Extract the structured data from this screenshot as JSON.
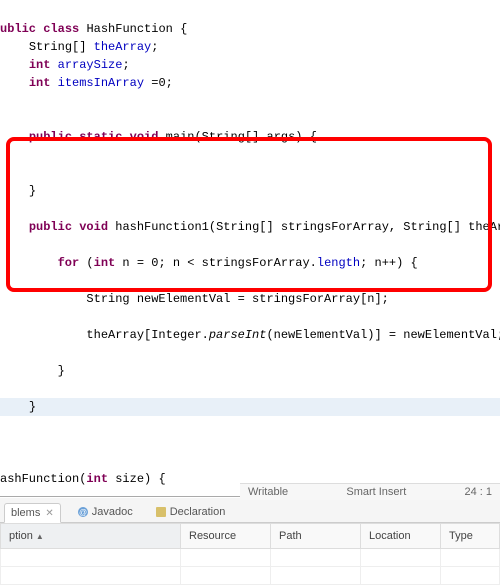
{
  "code": {
    "classDecl": {
      "kw1": "ublic",
      "kw2": "class",
      "name": "HashFunction",
      "brace": "{"
    },
    "field1": {
      "indent": "    ",
      "type": "String[]",
      "name": "theArray",
      "semi": ";"
    },
    "field2": {
      "indent": "    ",
      "kw": "int",
      "name": "arraySize",
      "semi": ";"
    },
    "field3": {
      "indent": "    ",
      "kw": "int",
      "name": "itemsInArray",
      "val": " =0;"
    },
    "main": {
      "indent": "    ",
      "kw1": "public",
      "kw2": "static",
      "kw3": "void",
      "name": "main",
      "params": "(String[] args) {"
    },
    "closeMain": {
      "indent": "    ",
      "brace": "}"
    },
    "hf1": {
      "indent": "    ",
      "kw1": "public",
      "kw2": "void",
      "name": "hashFunction1",
      "params": "(String[] stringsForArray, String[] theArray) {"
    },
    "forLine": {
      "indent": "        ",
      "kw": "for",
      "open": " (",
      "kwint": "int",
      "rest1": " n = 0; n < stringsForArray.",
      "len": "length",
      "rest2": "; n++) {"
    },
    "nev": {
      "indent": "            ",
      "text": "String newElementVal = stringsForArray[n];"
    },
    "assign": {
      "indent": "            ",
      "pre": "theArray[Integer.",
      "mid": "parseInt",
      "post": "(newElementVal)] = newElementVal;"
    },
    "closeFor": {
      "indent": "        ",
      "brace": "}"
    },
    "closeHf1": {
      "indent": "    ",
      "brace": "}"
    },
    "ctor": {
      "name": "ashFunction",
      "open": "(",
      "kw": "int",
      "rest": " size) {"
    }
  },
  "tabs": {
    "problems": "blems",
    "javadoc": "Javadoc",
    "declaration": "Declaration"
  },
  "table": {
    "cols": [
      "ption",
      "Resource",
      "Path",
      "Location",
      "Type"
    ]
  },
  "status": {
    "writable": "Writable",
    "insert": "Smart Insert",
    "pos": "24 : 1"
  }
}
